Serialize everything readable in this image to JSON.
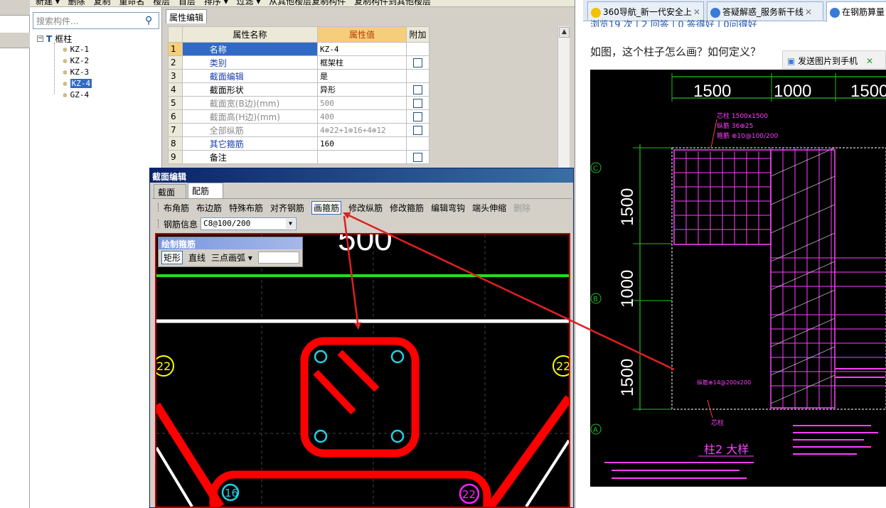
{
  "toolbar": {
    "items": [
      "新建 ▾",
      "删除",
      "复制",
      "重命名",
      "楼层",
      "首层",
      "排序 ▾",
      "过滤 ▾",
      "从其他楼层复制构件",
      "复制构件到其他楼层"
    ]
  },
  "tree": {
    "search_placeholder": "搜索构件...",
    "root": "框柱",
    "items": [
      "KZ-1",
      "KZ-2",
      "KZ-3",
      "KZ-4",
      "GZ-4"
    ],
    "selected": "KZ-4"
  },
  "properties": {
    "tab": "属性编辑",
    "col_name": "属性名称",
    "col_value": "属性值",
    "col_add": "附加",
    "rows": [
      {
        "num": "1",
        "name": "名称",
        "value": "KZ-4",
        "style": "sel",
        "cb": false
      },
      {
        "num": "2",
        "name": "类别",
        "value": "框架柱",
        "style": "blue",
        "cb": true
      },
      {
        "num": "3",
        "name": "截面编辑",
        "value": "是",
        "style": "blue",
        "cb": false
      },
      {
        "num": "4",
        "name": "截面形状",
        "value": "异形",
        "style": "",
        "cb": true
      },
      {
        "num": "5",
        "name": "截面宽(B边)(mm)",
        "value": "500",
        "style": "gray",
        "cb": true
      },
      {
        "num": "6",
        "name": "截面高(H边)(mm)",
        "value": "400",
        "style": "gray",
        "cb": true
      },
      {
        "num": "7",
        "name": "全部纵筋",
        "value": "4⊕22+1⊕16+4⊕12",
        "style": "gray",
        "cb": true
      },
      {
        "num": "8",
        "name": "其它箍筋",
        "value": "160",
        "style": "blue",
        "cb": false
      },
      {
        "num": "9",
        "name": "备注",
        "value": "",
        "style": "",
        "cb": true
      }
    ]
  },
  "dialog": {
    "title": "截面编辑",
    "tabs": [
      "截面",
      "配筋"
    ],
    "active_tab": "配筋",
    "tools": [
      "布角筋",
      "布边筋",
      "特殊布筋",
      "对齐钢筋",
      "画箍筋",
      "修改纵筋",
      "修改箍筋",
      "编辑弯钩",
      "端头伸缩",
      "删除"
    ],
    "pressed_tool": "画箍筋",
    "disabled_tool": "删除",
    "steel_label": "钢筋信息",
    "steel_value": "C8@100/200",
    "draw_panel": {
      "title": "绘制箍筋",
      "options": [
        "矩形",
        "直线",
        "三点画弧 ▾"
      ],
      "pressed": "矩形"
    },
    "canvas": {
      "dim_text": "500",
      "bar_labels": [
        "22",
        "22",
        "16",
        "22"
      ]
    }
  },
  "browser": {
    "tabs": [
      "360导航_新一代安全上",
      "答疑解惑_服务新干线",
      "在钢筋算量"
    ],
    "active_tab": "在钢筋算量",
    "stats": "浏览19 次 | 2 回答 | 0 答得好 | 0问得好",
    "question": "如图，这个柱子怎么画？如何定义？",
    "send_button": "发送图片到手机"
  },
  "cad": {
    "dims_top": [
      "1500",
      "1000",
      "1500"
    ],
    "dims_left": [
      "1500",
      "1000",
      "1500"
    ],
    "axis_labels": [
      "C",
      "B",
      "A"
    ],
    "title": "柱2 大样",
    "notes": [
      "芯柱 1500x1500",
      "纵筋 36⊕25",
      "箍筋 ⊕10@100/200",
      "纵筋⊕14@200x200",
      "芯柱",
      "柱2 大样"
    ]
  },
  "colors": {
    "selection": "#316ac5",
    "header_accent": "#f6cd7a",
    "rebar_red": "#ff0000",
    "cad_magenta": "#ff40ff",
    "cad_green": "#20c020",
    "annot_red": "#e02020"
  }
}
